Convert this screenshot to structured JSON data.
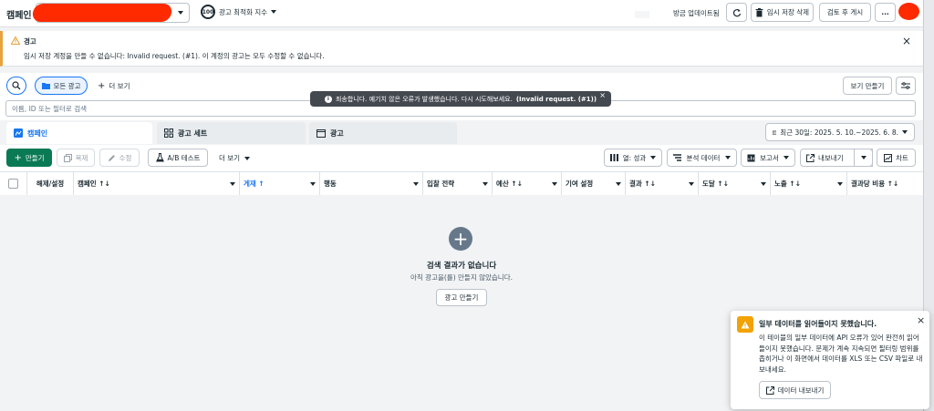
{
  "header": {
    "title": "캠페인",
    "account_name": "",
    "score_badge": "100",
    "score_label": "광고 최적화 지수",
    "recent_update": "방금 업데이트됨",
    "delete_draft": "임시 저장 삭제",
    "review_publish": "검토 후 게시",
    "more": "..."
  },
  "warning": {
    "title": "경고",
    "message": "임시 저장 계정을 만들 수 없습니다: Invalid request. (#1). 이 계정의 광고는 모두 수정할 수 없습니다."
  },
  "toolbar": {
    "all_ads": "모든 광고",
    "more_view": "더 보기",
    "create_view": "보기 만들기",
    "search_placeholder": "이름, ID 또는 필터로 검색"
  },
  "toast": {
    "text": "죄송합니다. 예기치 않은 오류가 발생했습니다. 다시 시도해보세요.",
    "bold": "(Invalid request. (#1))",
    "close": "×"
  },
  "tabs": [
    {
      "label": "캠페인"
    },
    {
      "label": "광고 세트"
    },
    {
      "label": "광고"
    }
  ],
  "date_range": "최근 30일: 2025. 5. 10.~2025. 6. 8.",
  "actions": {
    "create": "만들기",
    "duplicate": "복제",
    "edit": "수정",
    "ab_test": "A/B 테스트",
    "more": "더 보기",
    "columns": "열: 성과",
    "breakdown": "분석 데이터",
    "reports": "보고서",
    "export": "내보내기",
    "chart": "차트"
  },
  "table_headers": [
    "해제/설정",
    "캠페인 ↑↓",
    "게재 ↑",
    "행동",
    "입찰 전략",
    "예산 ↑↓",
    "기여 설정",
    "결과 ↑↓",
    "도달 ↑↓",
    "노출 ↑↓",
    "결과당 비용 ↑↓"
  ],
  "empty_state": {
    "title": "검색 결과가 없습니다",
    "subtitle": "아직 광고을(를) 만들지 않았습니다.",
    "button": "광고 만들기"
  },
  "notice": {
    "title": "일부 데이터를 읽어들이지 못했습니다.",
    "body": "이 테이블의 일부 데이터에 API 오류가 있어 완전히 읽어들이지 못했습니다. 문제가 계속 지속되면 필터링 범위를 좁히거나 이 화면에서 데이터를 XLS 또는 CSV 파일로 내보내세요.",
    "button": "데이터 내보내기"
  },
  "colors": {
    "accent": "#1877f2",
    "primary_green": "#0a7a55",
    "warning": "#e8a33d",
    "redaction": "#ff2a00"
  }
}
